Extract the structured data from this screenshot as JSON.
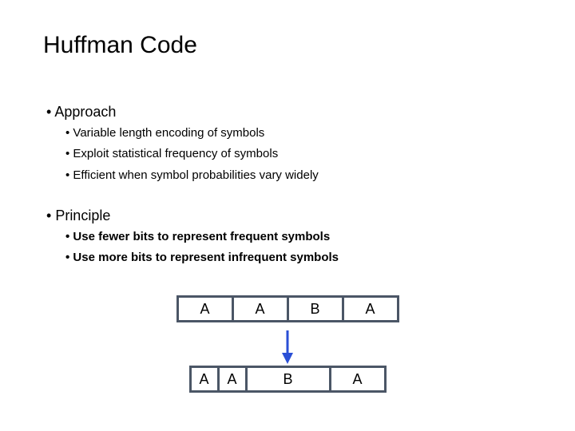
{
  "title": "Huffman Code",
  "section1": {
    "heading": "Approach",
    "items": [
      "Variable length encoding of symbols",
      "Exploit statistical frequency of symbols",
      "Efficient when symbol probabilities vary widely"
    ]
  },
  "section2": {
    "heading": "Principle",
    "items": [
      "Use fewer bits to represent frequent symbols",
      "Use more bits to represent infrequent symbols"
    ]
  },
  "row1": {
    "cells": [
      "A",
      "A",
      "B",
      "A"
    ],
    "widths": [
      "equal",
      "equal",
      "equal",
      "equal"
    ]
  },
  "row2": {
    "cells": [
      "A",
      "A",
      "B",
      "A"
    ],
    "widths": [
      "small",
      "small",
      "big",
      "mid"
    ]
  },
  "arrow_color": "#2a4fd6"
}
